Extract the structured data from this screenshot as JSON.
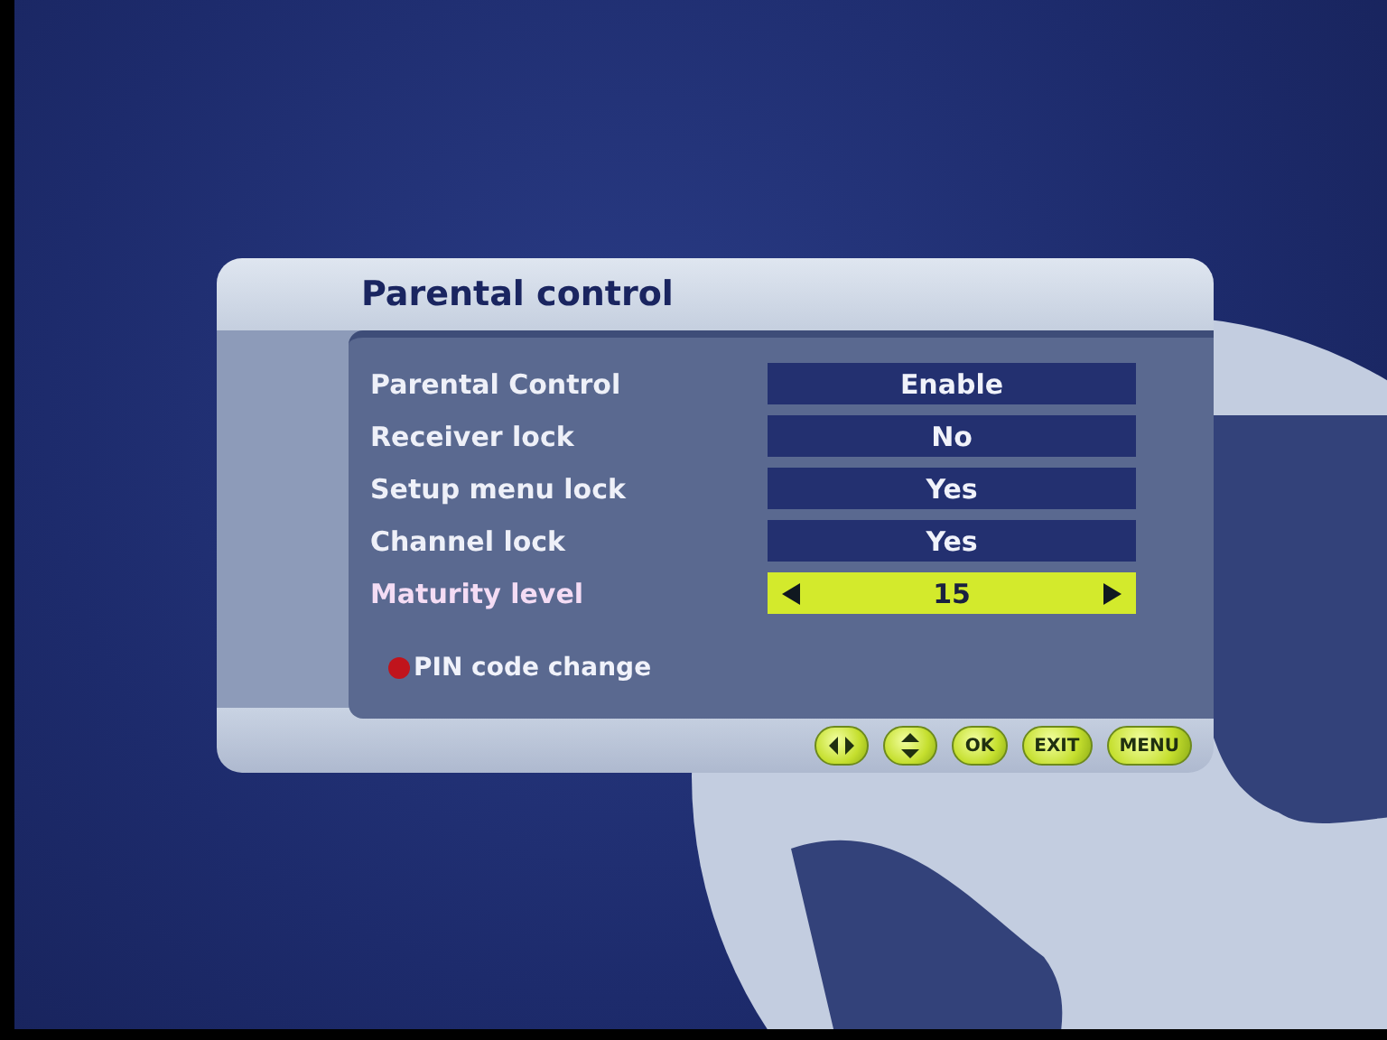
{
  "menu": {
    "title": "Parental control",
    "rows": [
      {
        "label": "Parental Control",
        "value": "Enable",
        "selected": false
      },
      {
        "label": "Receiver lock",
        "value": "No",
        "selected": false
      },
      {
        "label": "Setup menu lock",
        "value": "Yes",
        "selected": false
      },
      {
        "label": "Channel lock",
        "value": "Yes",
        "selected": false
      },
      {
        "label": "Maturity level",
        "value": "15",
        "selected": true
      }
    ],
    "action": {
      "label": "PIN code change"
    },
    "keys": [
      {
        "kind": "left-right"
      },
      {
        "kind": "up-down"
      },
      {
        "kind": "label",
        "label": "OK"
      },
      {
        "kind": "label",
        "label": "EXIT"
      },
      {
        "kind": "label",
        "label": "MENU"
      }
    ]
  }
}
